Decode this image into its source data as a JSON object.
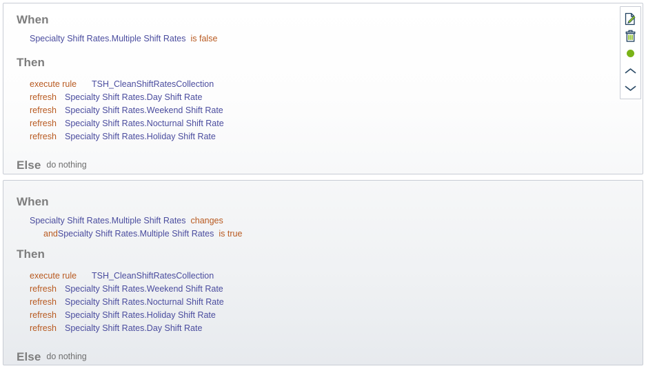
{
  "app": {
    "view_name": "business-rules-list"
  },
  "toolbar": {
    "items": [
      {
        "name": "edit-rule-button",
        "icon": "document-edit-icon",
        "label": "Edit rule"
      },
      {
        "name": "delete-rule-button",
        "icon": "trash-icon",
        "label": "Delete rule"
      },
      {
        "name": "rule-status-indicator",
        "icon": "green-dot-icon",
        "label": "Active"
      },
      {
        "name": "move-up-button",
        "icon": "chevron-up-icon",
        "label": "Move up"
      },
      {
        "name": "move-down-button",
        "icon": "chevron-down-icon",
        "label": "Move down"
      }
    ]
  },
  "colors": {
    "term": "#4a4c9e",
    "operator": "#b8591f",
    "heading": "#7d7d7d",
    "status_active": "#7ab317",
    "card_border": "#c8ccd4"
  },
  "rules": [
    {
      "when_label": "When",
      "then_label": "Then",
      "else_label": "Else",
      "else_text": "do nothing",
      "conditions": [
        {
          "term": "Specialty Shift Rates.Multiple Shift Rates",
          "operator": "is false",
          "conjunction": ""
        }
      ],
      "actions": [
        {
          "verb": "execute rule",
          "target": "TSH_CleanShiftRatesCollection",
          "type": "exec"
        },
        {
          "verb": "refresh",
          "target": "Specialty Shift Rates.Day Shift Rate",
          "type": "refresh"
        },
        {
          "verb": "refresh",
          "target": "Specialty Shift Rates.Weekend Shift Rate",
          "type": "refresh"
        },
        {
          "verb": "refresh",
          "target": "Specialty Shift Rates.Nocturnal Shift Rate",
          "type": "refresh"
        },
        {
          "verb": "refresh",
          "target": "Specialty Shift Rates.Holiday Shift Rate",
          "type": "refresh"
        }
      ]
    },
    {
      "when_label": "When",
      "then_label": "Then",
      "else_label": "Else",
      "else_text": "do nothing",
      "conditions": [
        {
          "term": "Specialty Shift Rates.Multiple Shift Rates",
          "operator": "changes",
          "conjunction": ""
        },
        {
          "term": "Specialty Shift Rates.Multiple Shift Rates",
          "operator": "is true",
          "conjunction": "and"
        }
      ],
      "actions": [
        {
          "verb": "execute rule",
          "target": "TSH_CleanShiftRatesCollection",
          "type": "exec"
        },
        {
          "verb": "refresh",
          "target": "Specialty Shift Rates.Weekend Shift Rate",
          "type": "refresh"
        },
        {
          "verb": "refresh",
          "target": "Specialty Shift Rates.Nocturnal Shift Rate",
          "type": "refresh"
        },
        {
          "verb": "refresh",
          "target": "Specialty Shift Rates.Holiday Shift Rate",
          "type": "refresh"
        },
        {
          "verb": "refresh",
          "target": "Specialty Shift Rates.Day Shift Rate",
          "type": "refresh"
        }
      ]
    }
  ]
}
